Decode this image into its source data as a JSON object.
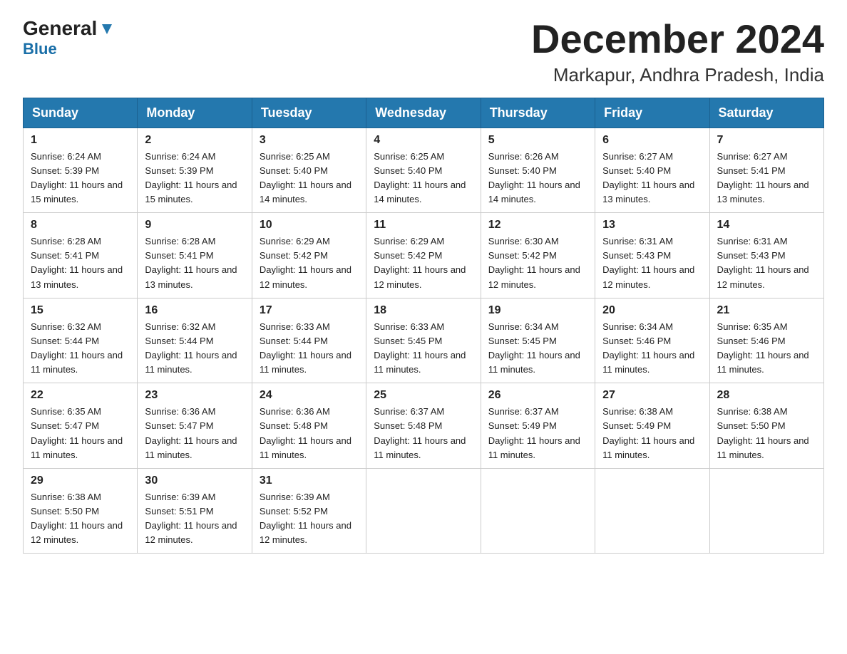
{
  "header": {
    "logo_general": "General",
    "logo_blue": "Blue",
    "month_title": "December 2024",
    "location": "Markapur, Andhra Pradesh, India"
  },
  "days_of_week": [
    "Sunday",
    "Monday",
    "Tuesday",
    "Wednesday",
    "Thursday",
    "Friday",
    "Saturday"
  ],
  "weeks": [
    [
      {
        "date": "1",
        "sunrise": "6:24 AM",
        "sunset": "5:39 PM",
        "daylight": "11 hours and 15 minutes."
      },
      {
        "date": "2",
        "sunrise": "6:24 AM",
        "sunset": "5:39 PM",
        "daylight": "11 hours and 15 minutes."
      },
      {
        "date": "3",
        "sunrise": "6:25 AM",
        "sunset": "5:40 PM",
        "daylight": "11 hours and 14 minutes."
      },
      {
        "date": "4",
        "sunrise": "6:25 AM",
        "sunset": "5:40 PM",
        "daylight": "11 hours and 14 minutes."
      },
      {
        "date": "5",
        "sunrise": "6:26 AM",
        "sunset": "5:40 PM",
        "daylight": "11 hours and 14 minutes."
      },
      {
        "date": "6",
        "sunrise": "6:27 AM",
        "sunset": "5:40 PM",
        "daylight": "11 hours and 13 minutes."
      },
      {
        "date": "7",
        "sunrise": "6:27 AM",
        "sunset": "5:41 PM",
        "daylight": "11 hours and 13 minutes."
      }
    ],
    [
      {
        "date": "8",
        "sunrise": "6:28 AM",
        "sunset": "5:41 PM",
        "daylight": "11 hours and 13 minutes."
      },
      {
        "date": "9",
        "sunrise": "6:28 AM",
        "sunset": "5:41 PM",
        "daylight": "11 hours and 13 minutes."
      },
      {
        "date": "10",
        "sunrise": "6:29 AM",
        "sunset": "5:42 PM",
        "daylight": "11 hours and 12 minutes."
      },
      {
        "date": "11",
        "sunrise": "6:29 AM",
        "sunset": "5:42 PM",
        "daylight": "11 hours and 12 minutes."
      },
      {
        "date": "12",
        "sunrise": "6:30 AM",
        "sunset": "5:42 PM",
        "daylight": "11 hours and 12 minutes."
      },
      {
        "date": "13",
        "sunrise": "6:31 AM",
        "sunset": "5:43 PM",
        "daylight": "11 hours and 12 minutes."
      },
      {
        "date": "14",
        "sunrise": "6:31 AM",
        "sunset": "5:43 PM",
        "daylight": "11 hours and 12 minutes."
      }
    ],
    [
      {
        "date": "15",
        "sunrise": "6:32 AM",
        "sunset": "5:44 PM",
        "daylight": "11 hours and 11 minutes."
      },
      {
        "date": "16",
        "sunrise": "6:32 AM",
        "sunset": "5:44 PM",
        "daylight": "11 hours and 11 minutes."
      },
      {
        "date": "17",
        "sunrise": "6:33 AM",
        "sunset": "5:44 PM",
        "daylight": "11 hours and 11 minutes."
      },
      {
        "date": "18",
        "sunrise": "6:33 AM",
        "sunset": "5:45 PM",
        "daylight": "11 hours and 11 minutes."
      },
      {
        "date": "19",
        "sunrise": "6:34 AM",
        "sunset": "5:45 PM",
        "daylight": "11 hours and 11 minutes."
      },
      {
        "date": "20",
        "sunrise": "6:34 AM",
        "sunset": "5:46 PM",
        "daylight": "11 hours and 11 minutes."
      },
      {
        "date": "21",
        "sunrise": "6:35 AM",
        "sunset": "5:46 PM",
        "daylight": "11 hours and 11 minutes."
      }
    ],
    [
      {
        "date": "22",
        "sunrise": "6:35 AM",
        "sunset": "5:47 PM",
        "daylight": "11 hours and 11 minutes."
      },
      {
        "date": "23",
        "sunrise": "6:36 AM",
        "sunset": "5:47 PM",
        "daylight": "11 hours and 11 minutes."
      },
      {
        "date": "24",
        "sunrise": "6:36 AM",
        "sunset": "5:48 PM",
        "daylight": "11 hours and 11 minutes."
      },
      {
        "date": "25",
        "sunrise": "6:37 AM",
        "sunset": "5:48 PM",
        "daylight": "11 hours and 11 minutes."
      },
      {
        "date": "26",
        "sunrise": "6:37 AM",
        "sunset": "5:49 PM",
        "daylight": "11 hours and 11 minutes."
      },
      {
        "date": "27",
        "sunrise": "6:38 AM",
        "sunset": "5:49 PM",
        "daylight": "11 hours and 11 minutes."
      },
      {
        "date": "28",
        "sunrise": "6:38 AM",
        "sunset": "5:50 PM",
        "daylight": "11 hours and 11 minutes."
      }
    ],
    [
      {
        "date": "29",
        "sunrise": "6:38 AM",
        "sunset": "5:50 PM",
        "daylight": "11 hours and 12 minutes."
      },
      {
        "date": "30",
        "sunrise": "6:39 AM",
        "sunset": "5:51 PM",
        "daylight": "11 hours and 12 minutes."
      },
      {
        "date": "31",
        "sunrise": "6:39 AM",
        "sunset": "5:52 PM",
        "daylight": "11 hours and 12 minutes."
      },
      null,
      null,
      null,
      null
    ]
  ],
  "labels": {
    "sunrise": "Sunrise:",
    "sunset": "Sunset:",
    "daylight": "Daylight:"
  }
}
